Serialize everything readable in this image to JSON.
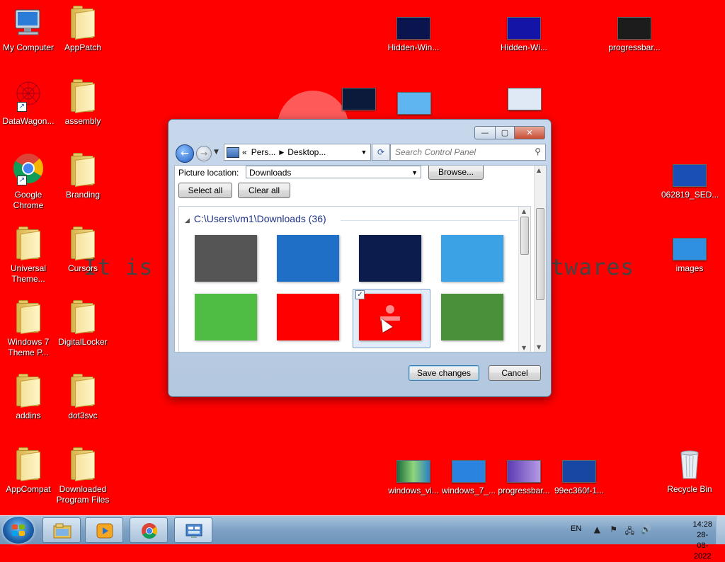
{
  "wallpaper": {
    "text_left": "It is aga",
    "text_right": "twares",
    "background_color": "#ff0000"
  },
  "desktop": {
    "left_icons": [
      {
        "label": "My Computer",
        "icon": "computer-icon"
      },
      {
        "label": "AppPatch",
        "icon": "folder-icon"
      },
      {
        "label": "DataWagon...",
        "icon": "datawagon-shortcut-icon"
      },
      {
        "label": "assembly",
        "icon": "folder-icon"
      },
      {
        "label": "Google\nChrome",
        "icon": "chrome-shortcut-icon"
      },
      {
        "label": "Branding",
        "icon": "folder-icon"
      },
      {
        "label": "Universal\nTheme...",
        "icon": "folder-icon"
      },
      {
        "label": "Cursors",
        "icon": "folder-icon"
      },
      {
        "label": "Windows 7\nTheme P...",
        "icon": "folder-icon"
      },
      {
        "label": "DigitalLocker",
        "icon": "folder-icon"
      },
      {
        "label": "addins",
        "icon": "folder-icon"
      },
      {
        "label": "dot3svc",
        "icon": "folder-icon"
      },
      {
        "label": "AppCompat",
        "icon": "folder-icon"
      },
      {
        "label": "Downloaded\nProgram Files",
        "icon": "folder-icon"
      }
    ],
    "top_right_icons": [
      {
        "label": "Hidden-Win...",
        "icon": "image-thumbnail-icon"
      },
      {
        "label": "Hidden-Wi...",
        "icon": "image-thumbnail-icon"
      },
      {
        "label": "progressbar...",
        "icon": "image-thumbnail-icon"
      }
    ],
    "right_icons": [
      {
        "label": "062819_SED...",
        "icon": "image-thumbnail-icon"
      },
      {
        "label": "images",
        "icon": "image-thumbnail-icon"
      },
      {
        "label": "Recycle Bin",
        "icon": "recycle-bin-icon"
      }
    ],
    "bottom_icons": [
      {
        "label": "windows_vi...",
        "icon": "image-thumbnail-icon"
      },
      {
        "label": "windows_7_...",
        "icon": "image-thumbnail-icon"
      },
      {
        "label": "progressbar...",
        "icon": "image-thumbnail-icon"
      },
      {
        "label": "99ec360f-1...",
        "icon": "image-thumbnail-icon"
      }
    ]
  },
  "dialog": {
    "window_buttons": {
      "minimize": "—",
      "maximize": "▢",
      "close": "✕"
    },
    "address": {
      "prefix": "«",
      "crumbs": [
        "Pers...",
        "Desktop..."
      ]
    },
    "search": {
      "placeholder": "Search Control Panel"
    },
    "picture_location_label": "Picture location:",
    "picture_location_value": "Downloads",
    "browse_label": "Browse...",
    "select_all_label": "Select all",
    "clear_all_label": "Clear all",
    "group_header": "C:\\Users\\vm1\\Downloads (36)",
    "thumbnails": [
      {
        "color": "#555555",
        "selected": false
      },
      {
        "color": "#1f6fc7",
        "selected": false
      },
      {
        "color": "#0c1c4c",
        "selected": false
      },
      {
        "color": "#3ba2e6",
        "selected": false
      },
      {
        "color": "#4fbd44",
        "selected": false
      },
      {
        "color": "#ff0000",
        "selected": false
      },
      {
        "color": "#ff0000",
        "selected": true
      },
      {
        "color": "#4a8f3a",
        "selected": false
      }
    ],
    "save_label": "Save changes",
    "cancel_label": "Cancel"
  },
  "taskbar": {
    "language": "EN",
    "time": "14:28",
    "date": "28-08-2022"
  },
  "colors": {
    "desktop_bg": "#ff0000",
    "accent": "#1e3287"
  }
}
